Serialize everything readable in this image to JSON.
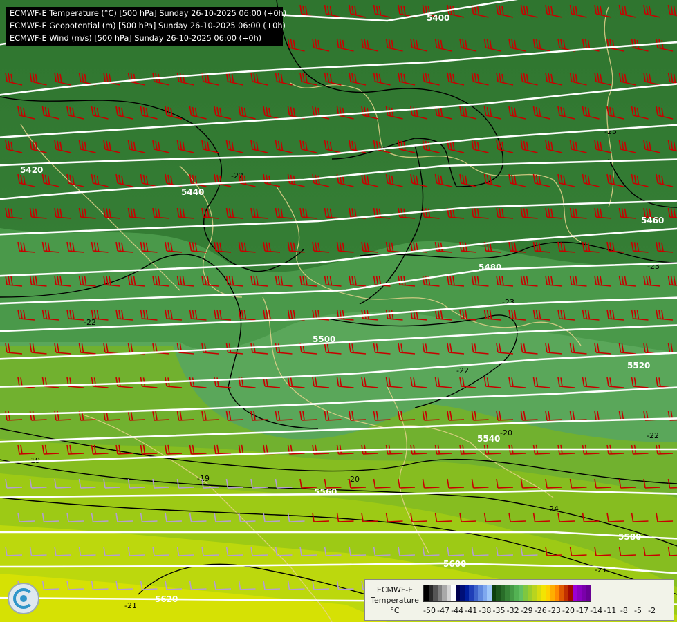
{
  "info": {
    "line1": "ECMWF-E Temperature (°C) [500 hPa] Sunday 26-10-2025 06:00 (+0h)",
    "line2": "ECMWF-E Geopotential (m) [500 hPa] Sunday 26-10-2025 06:00 (+0h)",
    "line3": "ECMWF-E Wind (m/s) [500 hPa] Sunday 26-10-2025 06:00 (+0h)"
  },
  "legend": {
    "title_line1": "ECMWF-E",
    "title_line2": "Temperature",
    "unit": "°C",
    "ticks": [
      "-50",
      "-47",
      "-44",
      "-41",
      "-38",
      "-35",
      "-32",
      "-29",
      "-26",
      "-23",
      "-20",
      "-17",
      "-14",
      "-11",
      "-8",
      "-5",
      "-2"
    ],
    "colors": [
      "#000000",
      "#2a2a2a",
      "#555555",
      "#7f7f7f",
      "#a9a9a9",
      "#d4d4d4",
      "#ffffff",
      "#00004f",
      "#000f77",
      "#001e9e",
      "#1f3fb8",
      "#3f65cc",
      "#5f88df",
      "#7fa8ef",
      "#a0c8fa",
      "#0d3f0d",
      "#1b561b",
      "#296d29",
      "#378437",
      "#459b45",
      "#53b253",
      "#62c062",
      "#7fc73f",
      "#9ccd2b",
      "#b9d41e",
      "#d6dc10",
      "#f3e402",
      "#ffd200",
      "#ffae00",
      "#ff8a00",
      "#e05a00",
      "#c13000",
      "#a20a00",
      "#9c00d6",
      "#8b00c0",
      "#7a00aa",
      "#690094"
    ]
  },
  "geopotential_labels": [
    "5400",
    "5420",
    "5440",
    "5460",
    "5480",
    "5500",
    "5520",
    "5540",
    "5560",
    "5580",
    "5600",
    "5620"
  ],
  "temperature_labels": [
    "-25",
    "-23",
    "-22",
    "-22",
    "-20",
    "-19",
    "-19",
    "-20",
    "-21",
    "-22",
    "-23",
    "-24",
    "-22",
    "-21"
  ],
  "colors": {
    "contour_geopotential": "#ffffff",
    "contour_temperature": "#000000",
    "wind_barb_strong": "#c80000",
    "wind_barb_weak": "#b49ed2",
    "borders": "#e6d28c"
  },
  "logo": "ecmwf-swirl-icon"
}
